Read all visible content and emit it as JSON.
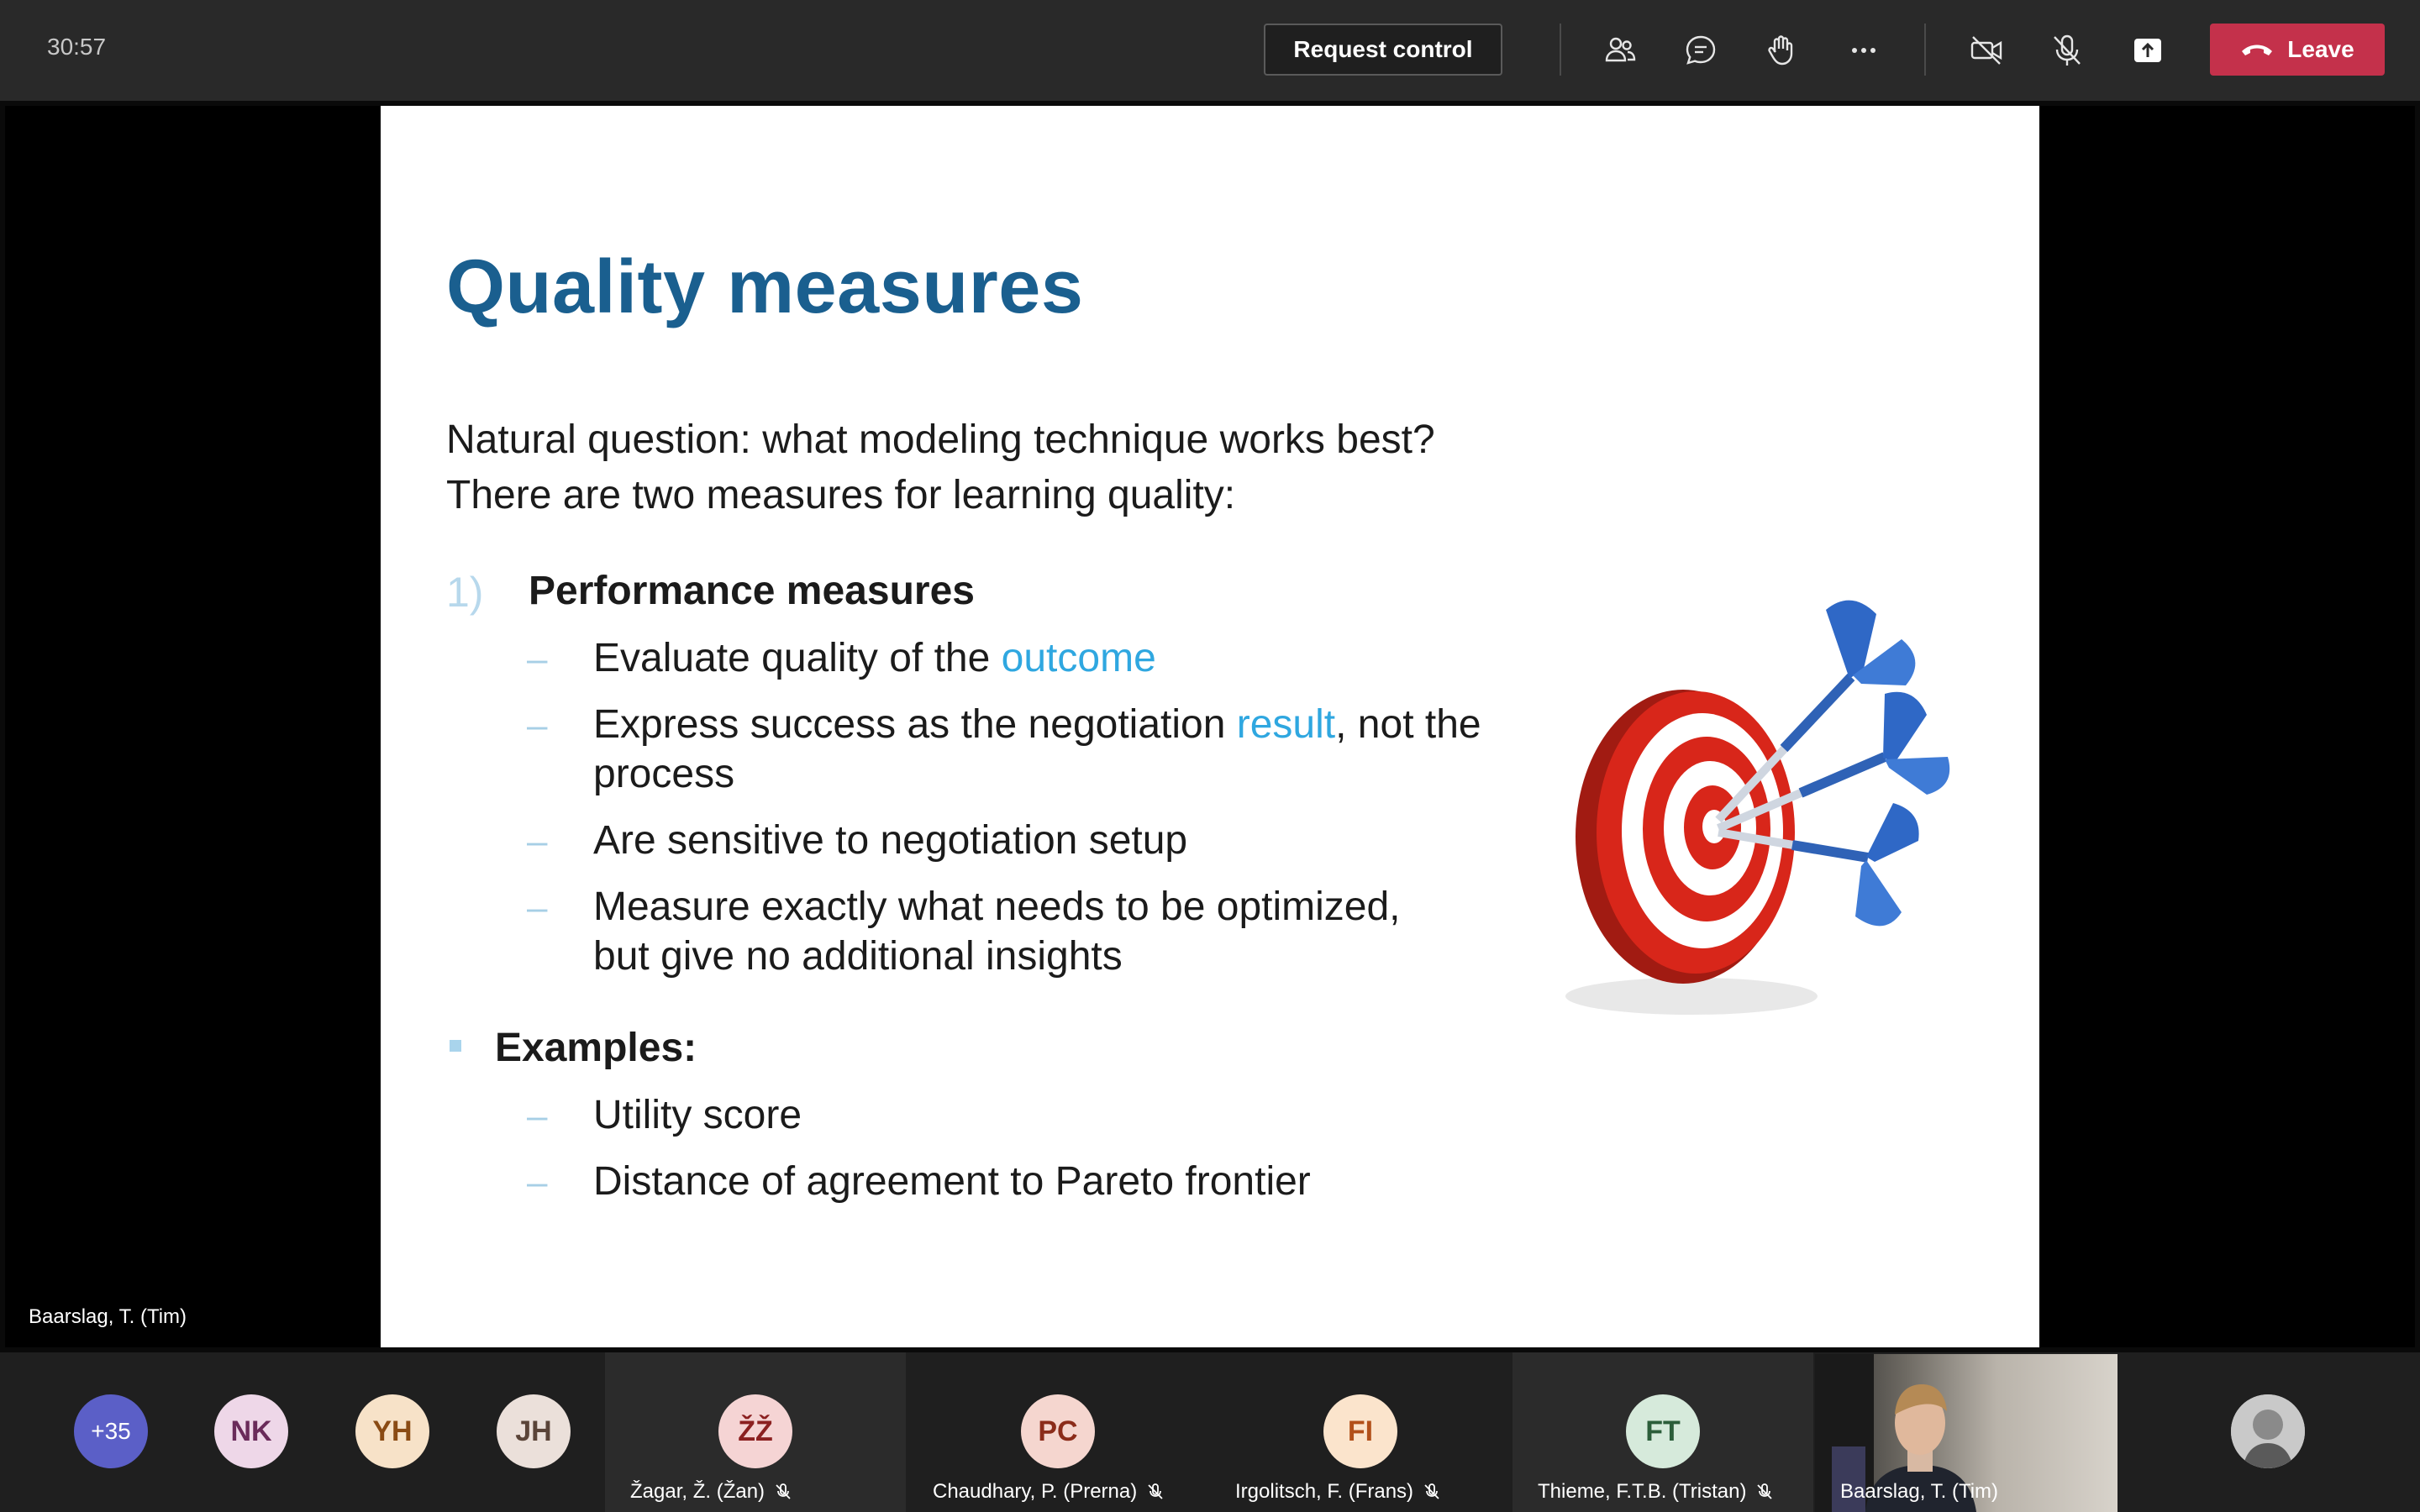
{
  "meeting": {
    "timer": "30:57",
    "request_control_label": "Request control",
    "leave_label": "Leave",
    "toolbar_icons": [
      "people-icon",
      "chat-icon",
      "raise-hand-icon",
      "more-options-icon",
      "camera-off-icon",
      "mic-off-icon",
      "share-tray-icon"
    ],
    "accent_color": "#c4314b"
  },
  "slide": {
    "title": "Quality measures",
    "intro_line_1": "Natural question: what modeling technique works best?",
    "intro_line_2": "There are two measures for learning quality:",
    "item1_number": "1)",
    "item1_heading": "Performance measures",
    "bullets": {
      "b1_pre": "Evaluate quality of the ",
      "b1_highlight": "outcome",
      "b2_pre": "Express success as the negotiation ",
      "b2_highlight": "result",
      "b2_post": ", not the",
      "b2_cont": "process",
      "b3": "Are sensitive to negotiation setup",
      "b4_line1": "Measure exactly what needs to be optimized,",
      "b4_line2": "but give no additional insights"
    },
    "examples_heading": "Examples:",
    "examples": [
      "Utility score",
      "Distance of agreement to Pareto frontier"
    ],
    "dash_glyph": "–",
    "title_color": "#1a5f8f",
    "highlight_color": "#2fa7e0"
  },
  "presenter_label": "Baarslag, T. (Tim)",
  "participants": {
    "overflow": "+35",
    "p_nk": "NK",
    "p_yh": "YH",
    "p_jh": "JH",
    "p_zz_initials": "ŽŽ",
    "p_zz_name": "Žagar, Ž. (Žan)",
    "p_pc_initials": "PC",
    "p_pc_name": "Chaudhary, P. (Prerna)",
    "p_fi_initials": "FI",
    "p_fi_name": "Irgolitsch, F. (Frans)",
    "p_ft_initials": "FT",
    "p_ft_name": "Thieme, F.T.B. (Tristan)",
    "video_name": "Baarslag, T. (Tim)"
  }
}
